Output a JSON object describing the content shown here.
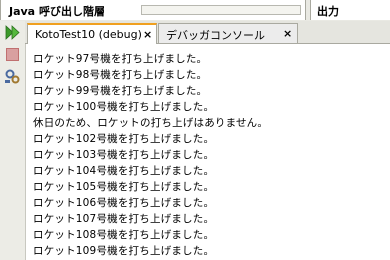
{
  "panels": {
    "left_title": "Java 呼び出し階層",
    "right_title": "出力"
  },
  "tabs": [
    {
      "label": "KotoTest10 (debug)",
      "close": "×"
    },
    {
      "label": "デバッガコンソール",
      "close": "×"
    }
  ],
  "toolbar": {
    "icons": [
      "rerun-icon",
      "stop-icon",
      "settings-icon"
    ]
  },
  "console": {
    "lines": [
      "ロケット97号機を打ち上げました。",
      "ロケット98号機を打ち上げました。",
      "ロケット99号機を打ち上げました。",
      "ロケット100号機を打ち上げました。",
      "休日のため、ロケットの打ち上げはありません。",
      "ロケット102号機を打ち上げました。",
      "ロケット103号機を打ち上げました。",
      "ロケット104号機を打ち上げました。",
      "ロケット105号機を打ち上げました。",
      "ロケット106号機を打ち上げました。",
      "ロケット107号機を打ち上げました。",
      "ロケット108号機を打ち上げました。",
      "ロケット109号機を打ち上げました。"
    ]
  }
}
